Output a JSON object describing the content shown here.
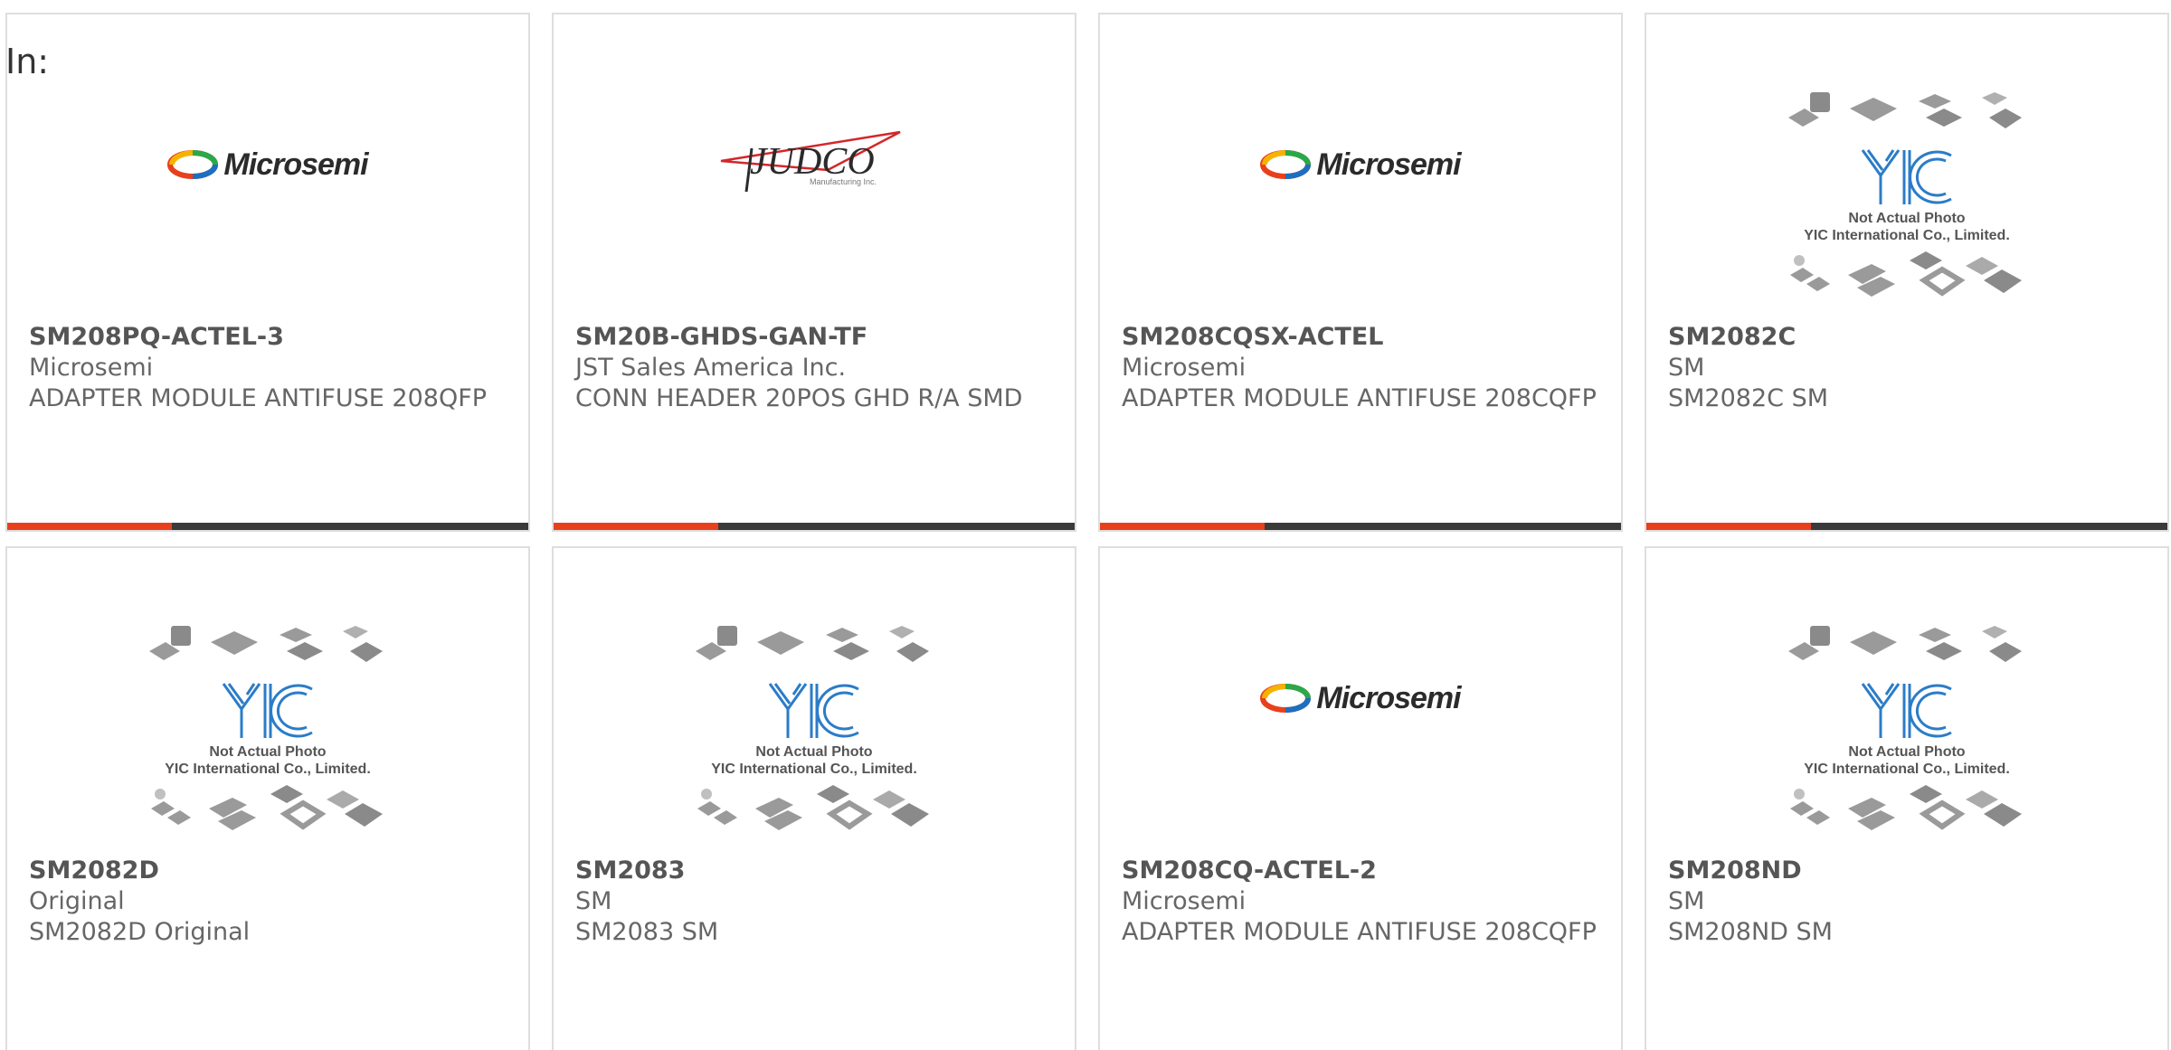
{
  "page": {
    "filter_label": "In:"
  },
  "colors": {
    "accent": "#e8401c",
    "bar_dark": "#3a3a3a",
    "card_border": "#dedede",
    "yic_blue": "#2b7cc8"
  },
  "placeholder": {
    "line1": "Not Actual Photo",
    "line2": "YIC International Co., Limited."
  },
  "logos": {
    "microsemi": "Microsemi",
    "judco": "JUDCO",
    "judco_sub": "Manufacturing Inc."
  },
  "products": [
    {
      "part_number": "SM208PQ-ACTEL-3",
      "manufacturer": "Microsemi",
      "description": "ADAPTER MODULE ANTIFUSE 208QFP",
      "image": "microsemi-logo"
    },
    {
      "part_number": "SM20B-GHDS-GAN-TF",
      "manufacturer": "JST Sales America Inc.",
      "description": "CONN HEADER 20POS GHD R/A SMD",
      "image": "judco-logo"
    },
    {
      "part_number": "SM208CQSX-ACTEL",
      "manufacturer": "Microsemi",
      "description": "ADAPTER MODULE ANTIFUSE 208CQFP",
      "image": "microsemi-logo"
    },
    {
      "part_number": "SM2082C",
      "manufacturer": "SM",
      "description": "SM2082C SM",
      "image": "yic-placeholder"
    },
    {
      "part_number": "SM2082D",
      "manufacturer": "Original",
      "description": "SM2082D Original",
      "image": "yic-placeholder"
    },
    {
      "part_number": "SM2083",
      "manufacturer": "SM",
      "description": "SM2083 SM",
      "image": "yic-placeholder"
    },
    {
      "part_number": "SM208CQ-ACTEL-2",
      "manufacturer": "Microsemi",
      "description": "ADAPTER MODULE ANTIFUSE 208CQFP",
      "image": "microsemi-logo"
    },
    {
      "part_number": "SM208ND",
      "manufacturer": "SM",
      "description": "SM208ND SM",
      "image": "yic-placeholder"
    }
  ]
}
